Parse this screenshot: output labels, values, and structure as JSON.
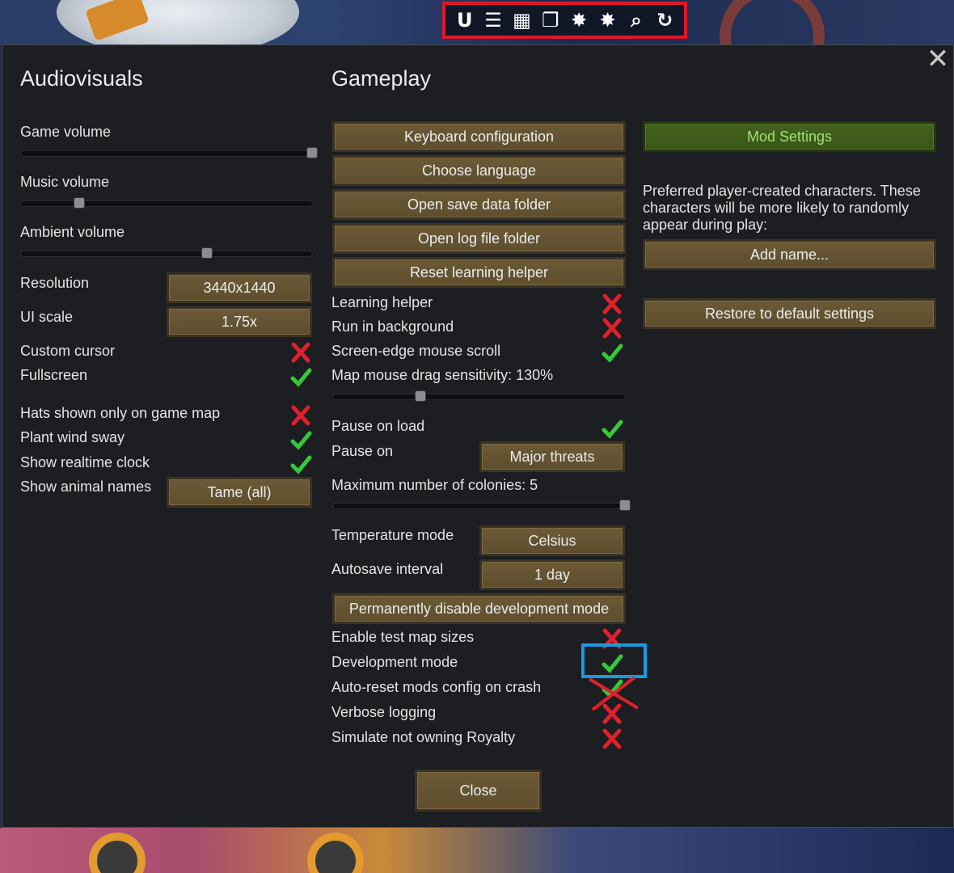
{
  "toolbar": {
    "icons": [
      "U",
      "☰",
      "▦",
      "❐",
      "✸",
      "✸",
      "⌕",
      "↻"
    ],
    "icon_names": [
      "u-icon",
      "list-icon",
      "grid-icon",
      "copy-icon",
      "debug-star-icon",
      "debug-star-icon-2",
      "magnify-icon",
      "refresh-icon"
    ]
  },
  "dialog": {
    "close_glyph": "✕",
    "audiovisuals": {
      "title": "Audiovisuals",
      "game_volume": {
        "label": "Game volume",
        "value": 1.0
      },
      "music_volume": {
        "label": "Music volume",
        "value": 0.2
      },
      "ambient_volume": {
        "label": "Ambient volume",
        "value": 0.64
      },
      "resolution": {
        "label": "Resolution",
        "value": "3440x1440"
      },
      "ui_scale": {
        "label": "UI scale",
        "value": "1.75x"
      },
      "custom_cursor": {
        "label": "Custom cursor",
        "checked": false
      },
      "fullscreen": {
        "label": "Fullscreen",
        "checked": true
      },
      "hats_map_only": {
        "label": "Hats shown only on game map",
        "checked": false
      },
      "plant_sway": {
        "label": "Plant wind sway",
        "checked": true
      },
      "realtime_clock": {
        "label": "Show realtime clock",
        "checked": true
      },
      "animal_names": {
        "label": "Show animal names",
        "value": "Tame (all)"
      }
    },
    "gameplay": {
      "title": "Gameplay",
      "buttons": {
        "keyboard": "Keyboard configuration",
        "language": "Choose language",
        "save_folder": "Open save data folder",
        "log_folder": "Open log file folder",
        "reset_helper": "Reset learning helper",
        "disable_dev": "Permanently disable development mode",
        "close": "Close"
      },
      "learning_helper": {
        "label": "Learning helper",
        "checked": false
      },
      "run_background": {
        "label": "Run in background",
        "checked": false
      },
      "edge_scroll": {
        "label": "Screen-edge mouse scroll",
        "checked": true
      },
      "drag_sensitivity": {
        "label": "Map mouse drag sensitivity: 130%",
        "value": 0.3
      },
      "pause_on_load": {
        "label": "Pause on load",
        "checked": true
      },
      "pause_on": {
        "label": "Pause on",
        "value": "Major threats"
      },
      "max_colonies": {
        "label": "Maximum number of colonies: 5",
        "value": 1.0
      },
      "temperature": {
        "label": "Temperature mode",
        "value": "Celsius"
      },
      "autosave": {
        "label": "Autosave interval",
        "value": "1 day"
      },
      "test_map_sizes": {
        "label": "Enable test map sizes",
        "checked": false
      },
      "dev_mode": {
        "label": "Development mode",
        "checked": true
      },
      "auto_reset_mods": {
        "label": "Auto-reset mods config on crash",
        "checked": true
      },
      "verbose_logging": {
        "label": "Verbose logging",
        "checked": false
      },
      "simulate_royalty": {
        "label": "Simulate not owning Royalty",
        "checked": false
      }
    },
    "right": {
      "mod_settings": "Mod Settings",
      "preferred_text": "Preferred player-created characters. These characters will be more likely to randomly appear during play:",
      "add_name": "Add name...",
      "restore_defaults": "Restore to default settings"
    }
  },
  "colors": {
    "check_green": "#35c93a",
    "cross_red": "#e0202c",
    "highlight_blue": "#1a9ae0",
    "toolbar_border": "#e0172a"
  }
}
